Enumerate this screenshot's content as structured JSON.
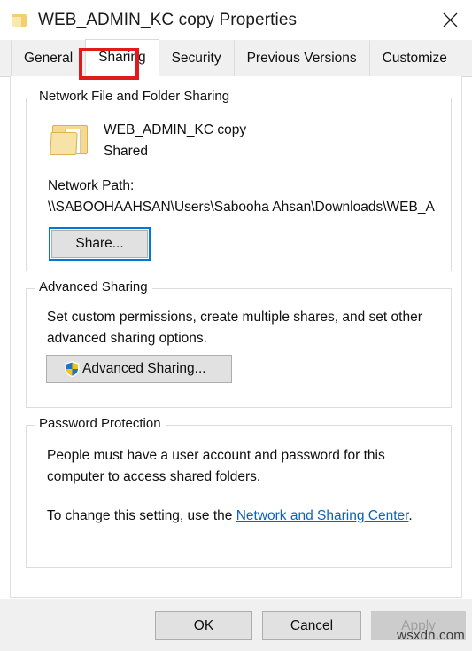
{
  "window": {
    "title": "WEB_ADMIN_KC copy Properties",
    "folder_icon": "folder-icon",
    "close_icon": "close-icon"
  },
  "tabs": [
    {
      "label": "General",
      "active": false
    },
    {
      "label": "Sharing",
      "active": true
    },
    {
      "label": "Security",
      "active": false
    },
    {
      "label": "Previous Versions",
      "active": false
    },
    {
      "label": "Customize",
      "active": false
    }
  ],
  "highlight": {
    "target_tab": "Sharing",
    "color": "#e01b1b"
  },
  "network_sharing": {
    "legend": "Network File and Folder Sharing",
    "folder_icon": "folder-icon",
    "share_name": "WEB_ADMIN_KC copy",
    "share_status": "Shared",
    "path_label": "Network Path:",
    "path_value": "\\\\SABOOHAAHSAN\\Users\\Sabooha Ahsan\\Downloads\\WEB_A",
    "share_button": "Share..."
  },
  "advanced_sharing": {
    "legend": "Advanced Sharing",
    "description": "Set custom permissions, create multiple shares, and set other advanced sharing options.",
    "button_label": "Advanced Sharing...",
    "button_icon": "uac-shield-icon"
  },
  "password_protection": {
    "legend": "Password Protection",
    "description": "People must have a user account and password for this computer to access shared folders.",
    "note_prefix": "To change this setting, use the ",
    "link_text": "Network and Sharing Center",
    "note_suffix": "."
  },
  "footer": {
    "ok_label": "OK",
    "cancel_label": "Cancel",
    "apply_label": "Apply"
  },
  "watermark": {
    "text": "wsxdn.com"
  },
  "colors": {
    "accent": "#0078d7",
    "link": "#0b64b8",
    "highlight_red": "#e01b1b",
    "window_bg": "#ffffff",
    "footer_bg": "#f0f0f0"
  }
}
